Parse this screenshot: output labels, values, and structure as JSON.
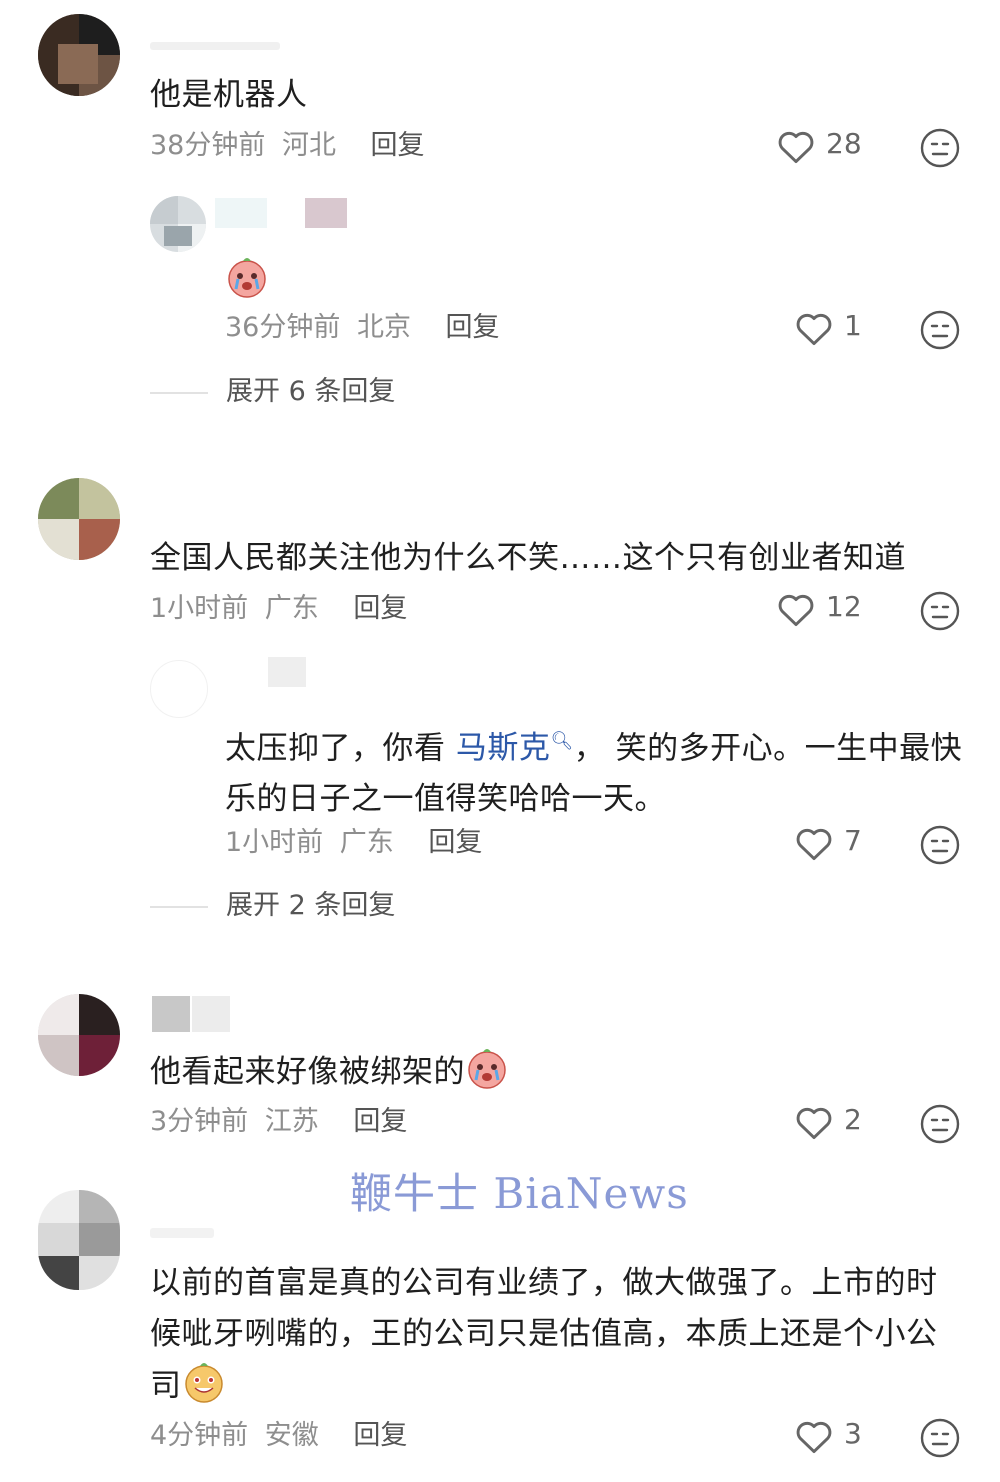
{
  "watermark": "鞭牛士 BiaNews",
  "comments": [
    {
      "text": "他是机器人",
      "time": "38分钟前",
      "location": "河北",
      "reply_label": "回复",
      "likes": "28",
      "replies": [
        {
          "text": "",
          "time": "36分钟前",
          "location": "北京",
          "reply_label": "回复",
          "likes": "1"
        }
      ],
      "expand_label": "展开 6 条回复"
    },
    {
      "text": "全国人民都关注他为什么不笑……这个只有创业者知道",
      "time": "1小时前",
      "location": "广东",
      "reply_label": "回复",
      "likes": "12",
      "replies": [
        {
          "text_before": "太压抑了，你看 ",
          "mention": "马斯克",
          "text_after": "， 笑的多开心。一生中最快乐的日子之一值得笑哈哈一天。",
          "time": "1小时前",
          "location": "广东",
          "reply_label": "回复",
          "likes": "7"
        }
      ],
      "expand_label": "展开 2 条回复"
    },
    {
      "text": "他看起来好像被绑架的",
      "time": "3分钟前",
      "location": "江苏",
      "reply_label": "回复",
      "likes": "2"
    },
    {
      "text": "以前的首富是真的公司有业绩了，做大做强了。上市的时候呲牙咧嘴的，王的公司只是估值高，本质上还是个小公司",
      "time": "4分钟前",
      "location": "安徽",
      "reply_label": "回复",
      "likes": "3"
    }
  ],
  "icons": {
    "like": "heart-outline-icon",
    "dislike": "neutral-face-icon",
    "search": "search-icon"
  },
  "colors": {
    "text": "#1f1f1f",
    "meta": "#8e8e8e",
    "mention": "#2c58a8",
    "watermark": "#8a9ad6"
  }
}
